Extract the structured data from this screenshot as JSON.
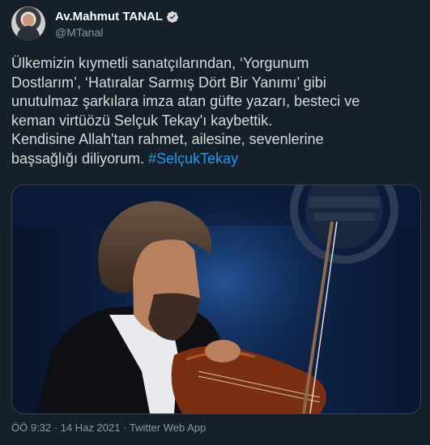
{
  "author": {
    "display_name": "Av.Mahmut TANAL",
    "handle": "@MTanal"
  },
  "tweet": {
    "text": "Ülkemizin kıymetli sanatçılarından, ‘Yorgunum\nDostlarım’, ‘Hatıralar Sarmış Dört Bir Yanımı’ gibi\nunutulmaz şarkılara imza atan güfte yazarı, besteci ve\nkeman virtüözü Selçuk Tekay'ı kaybettik.\nKendisine Allah'tan rahmet, ailesine, sevenlerine\nbaşsağlığı diliyorum. ",
    "hashtag": "#SelçukTekay"
  },
  "meta": {
    "time": "ÖÖ 9:32",
    "separator1": "·",
    "date": "14 Haz 2021",
    "separator2": "·",
    "source": "Twitter Web App"
  },
  "colors": {
    "background": "#15202b",
    "text": "#d9d9d9",
    "secondary": "#8899a6",
    "link": "#1d9bf0",
    "verified": "#d9d9d9"
  },
  "icons": {
    "verified": "verified-badge-icon"
  }
}
